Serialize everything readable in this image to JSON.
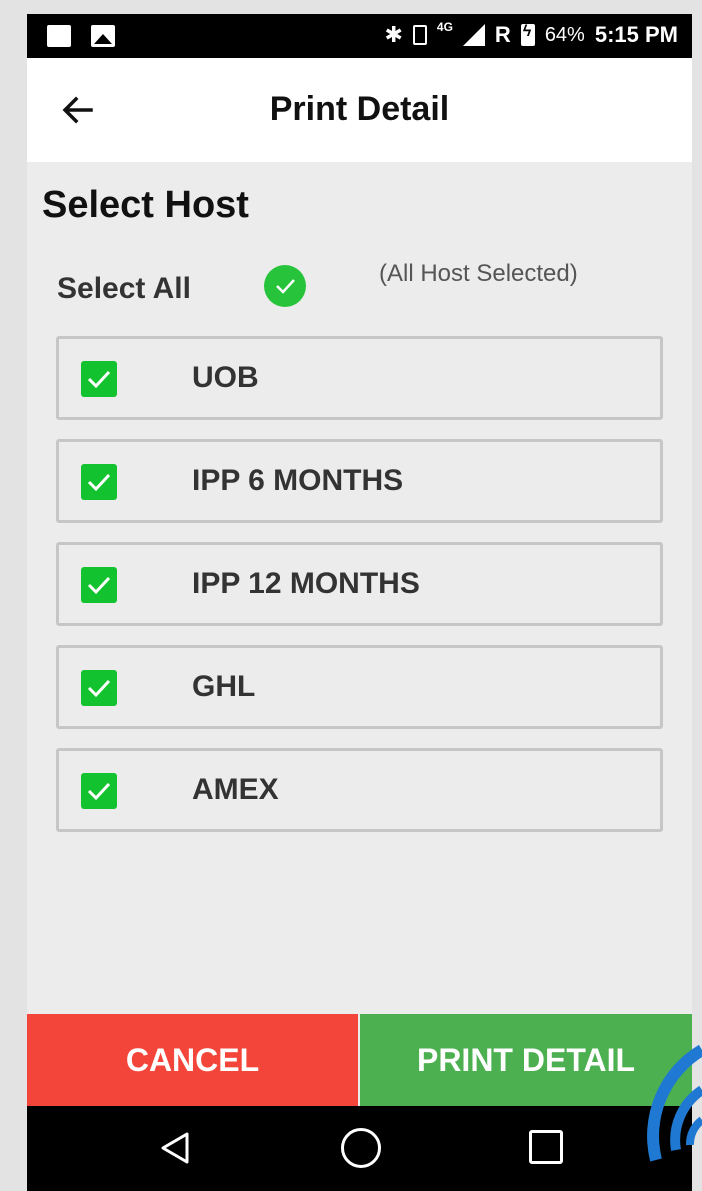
{
  "status_bar": {
    "network": "4G",
    "roaming": "R",
    "battery": "64%",
    "time": "5:15 PM"
  },
  "toolbar": {
    "title": "Print Detail"
  },
  "main": {
    "section_title": "Select Host",
    "select_all_label": "Select All",
    "select_all_note": "(All Host Selected)",
    "hosts": [
      {
        "label": "UOB",
        "checked": true
      },
      {
        "label": "IPP 6 MONTHS",
        "checked": true
      },
      {
        "label": "IPP 12 MONTHS",
        "checked": true
      },
      {
        "label": "GHL",
        "checked": true
      },
      {
        "label": "AMEX",
        "checked": true
      }
    ]
  },
  "actions": {
    "cancel_label": "CANCEL",
    "print_label": "PRINT DETAIL"
  },
  "colors": {
    "cancel": "#f4453a",
    "print": "#4caf50",
    "check": "#12c32f"
  }
}
